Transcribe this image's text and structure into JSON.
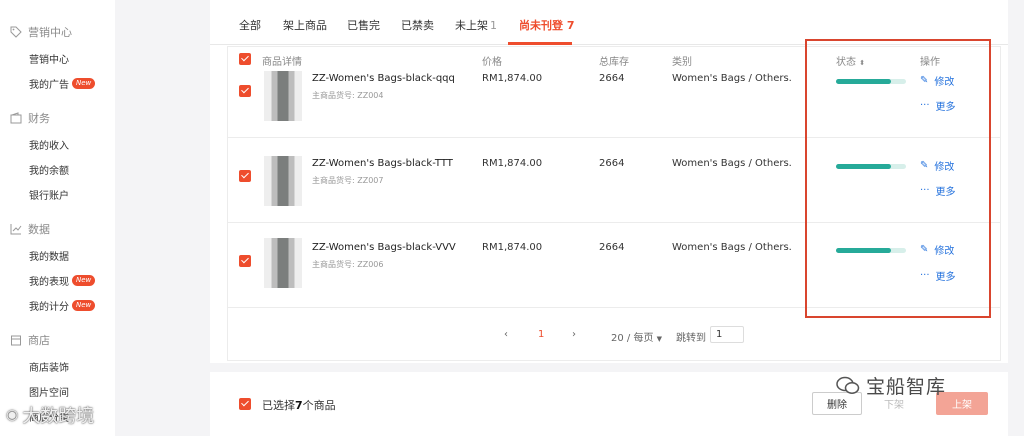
{
  "sidebar": {
    "sections": [
      {
        "title": "营销中心",
        "icon": "tag-icon",
        "items": [
          {
            "label": "营销中心",
            "badge": ""
          },
          {
            "label": "我的广告",
            "badge": "New"
          }
        ]
      },
      {
        "title": "财务",
        "icon": "wallet-icon",
        "items": [
          {
            "label": "我的收入",
            "badge": ""
          },
          {
            "label": "我的余额",
            "badge": ""
          },
          {
            "label": "银行账户",
            "badge": ""
          }
        ]
      },
      {
        "title": "数据",
        "icon": "chart-icon",
        "items": [
          {
            "label": "我的数据",
            "badge": ""
          },
          {
            "label": "我的表现",
            "badge": "New"
          },
          {
            "label": "我的计分",
            "badge": "New"
          }
        ]
      },
      {
        "title": "商店",
        "icon": "shop-icon",
        "items": [
          {
            "label": "商店装饰",
            "badge": ""
          },
          {
            "label": "图片空间",
            "badge": ""
          },
          {
            "label": "商店分类",
            "badge": ""
          }
        ]
      }
    ]
  },
  "tabs": [
    {
      "label": "全部",
      "count": ""
    },
    {
      "label": "架上商品",
      "count": ""
    },
    {
      "label": "已售完",
      "count": ""
    },
    {
      "label": "已禁卖",
      "count": ""
    },
    {
      "label": "未上架",
      "count": "1"
    },
    {
      "label": "尚未刊登",
      "count": "7"
    }
  ],
  "table": {
    "headers": {
      "product": "商品详情",
      "price": "价格",
      "stock": "总库存",
      "category": "类别",
      "status": "状态",
      "actions": "操作"
    },
    "rows": [
      {
        "name": "ZZ-Women's Bags-black-qqq",
        "sku_label": "主商品货号:",
        "sku": "ZZ004",
        "price": "RM1,874.00",
        "stock": "2664",
        "category": "Women's Bags / Others.",
        "completeness": 0.78,
        "edit": "修改",
        "more": "更多"
      },
      {
        "name": "ZZ-Women's Bags-black-TTT",
        "sku_label": "主商品货号:",
        "sku": "ZZ007",
        "price": "RM1,874.00",
        "stock": "2664",
        "category": "Women's Bags / Others.",
        "completeness": 0.78,
        "edit": "修改",
        "more": "更多"
      },
      {
        "name": "ZZ-Women's Bags-black-VVV",
        "sku_label": "主商品货号:",
        "sku": "ZZ006",
        "price": "RM1,874.00",
        "stock": "2664",
        "category": "Women's Bags / Others.",
        "completeness": 0.78,
        "edit": "修改",
        "more": "更多"
      }
    ]
  },
  "pagination": {
    "prev": "‹",
    "current": "1",
    "next": "›",
    "per_page": "20 / 每页",
    "jump_label": "跳转到",
    "jump_value": "1"
  },
  "bottom": {
    "selected_prefix": "已选择",
    "selected_count": "7",
    "selected_suffix": "个商品",
    "delete": "删除",
    "unlist": "下架",
    "list": "上架"
  },
  "watermarks": {
    "right": "宝船智库",
    "left": "大数跨境"
  },
  "colors": {
    "accent": "#ee4d2d",
    "status": "#26aa99",
    "link": "#2673dd",
    "highlight_box": "#d9452e"
  }
}
